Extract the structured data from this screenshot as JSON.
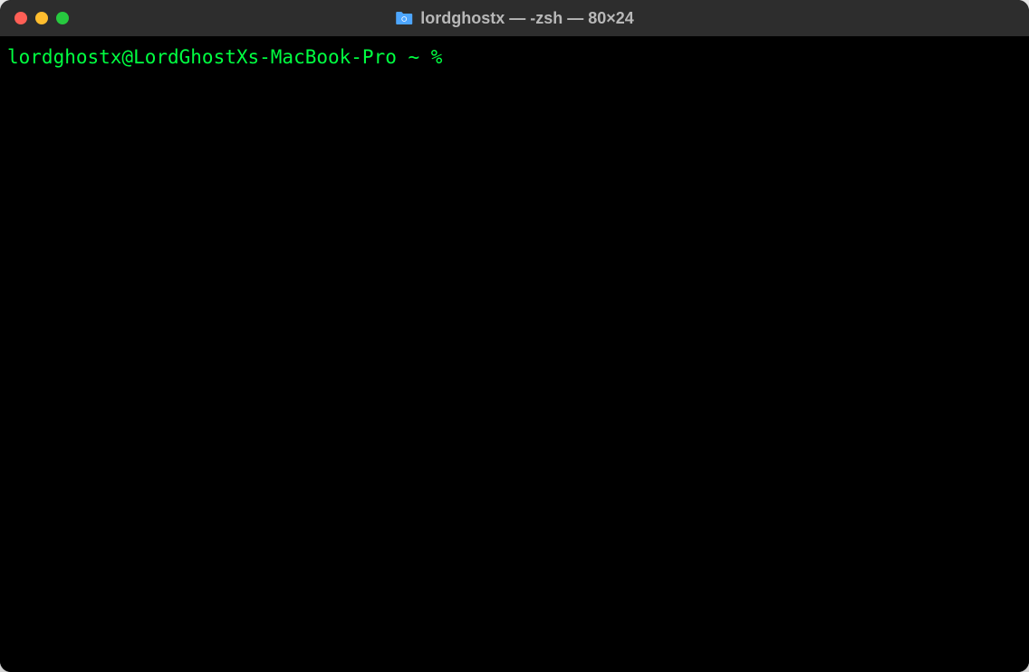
{
  "titlebar": {
    "title": "lordghostx — -zsh — 80×24",
    "folder_icon": "folder-icon"
  },
  "terminal": {
    "prompt": "lordghostx@LordGhostXs-MacBook-Pro ~ % "
  },
  "colors": {
    "prompt_color": "#00ff41",
    "background": "#000000",
    "titlebar_bg": "#2d2d2d",
    "titlebar_text": "#b8b8b8"
  }
}
